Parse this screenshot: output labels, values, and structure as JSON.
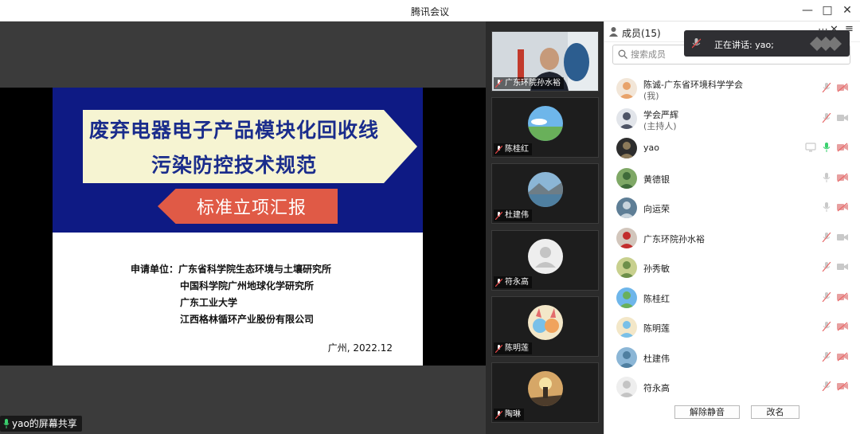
{
  "window": {
    "title": "腾讯会议"
  },
  "slide": {
    "title_line1": "废弃电器电子产品模块化回收线",
    "title_line2": "污染防控技术规范",
    "subtitle": "标准立项汇报",
    "applicant_label": "申请单位：",
    "applicants": [
      "广东省科学院生态环境与土壤研究所",
      "中国科学院广州地球化学研究所",
      "广东工业大学",
      "江西格林循环产业股份有限公司"
    ],
    "date": "广州, 2022.12"
  },
  "share_badge": "yao的屏幕共享",
  "thumbnails": [
    {
      "name": "广东环院孙水裕",
      "kind": "video"
    },
    {
      "name": "陈桂红",
      "kind": "avatar",
      "avatar": "sky"
    },
    {
      "name": "杜建伟",
      "kind": "avatar",
      "avatar": "lake"
    },
    {
      "name": "符永高",
      "kind": "avatar",
      "avatar": "default"
    },
    {
      "name": "陈明莲",
      "kind": "avatar",
      "avatar": "cartoon"
    },
    {
      "name": "陶琳",
      "kind": "avatar",
      "avatar": "sunset"
    }
  ],
  "members_panel": {
    "title": "成员(15)",
    "search_placeholder": "搜索成员",
    "members": [
      {
        "name": "陈诚-广东省环境科学学会",
        "sub": "(我)",
        "mic": "muted",
        "cam": "off"
      },
      {
        "name": "学会严辉",
        "sub": "(主持人)",
        "mic": "muted",
        "cam": "on"
      },
      {
        "name": "yao",
        "sub": "",
        "mic": "active",
        "cam": "off",
        "sharing": true
      },
      {
        "name": "黄德银",
        "sub": "",
        "mic": "on",
        "cam": "off"
      },
      {
        "name": "向运荣",
        "sub": "",
        "mic": "on",
        "cam": "off"
      },
      {
        "name": "广东环院孙水裕",
        "sub": "",
        "mic": "muted",
        "cam": "on"
      },
      {
        "name": "孙秀敏",
        "sub": "",
        "mic": "muted",
        "cam": "on"
      },
      {
        "name": "陈桂红",
        "sub": "",
        "mic": "muted",
        "cam": "off"
      },
      {
        "name": "陈明莲",
        "sub": "",
        "mic": "muted",
        "cam": "off"
      },
      {
        "name": "杜建伟",
        "sub": "",
        "mic": "muted",
        "cam": "off"
      },
      {
        "name": "符永高",
        "sub": "",
        "mic": "muted",
        "cam": "off"
      }
    ],
    "unmute_button": "解除静音",
    "rename_button": "改名"
  },
  "speaking_toast": "正在讲话: yao;"
}
